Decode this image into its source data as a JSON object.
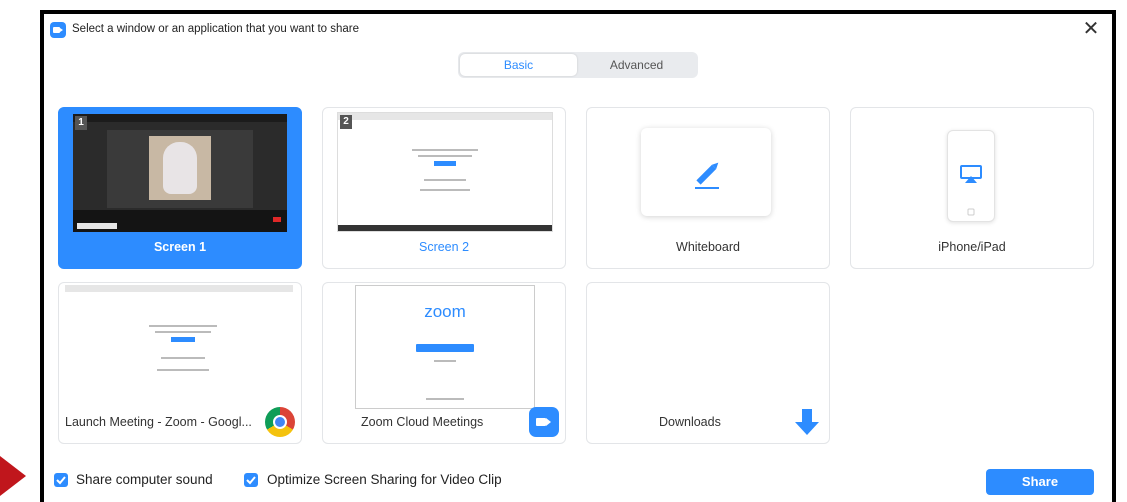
{
  "dialog": {
    "title": "Select a window or an application that you want to share",
    "close": "✕"
  },
  "tabs": [
    {
      "label": "Basic",
      "active": true
    },
    {
      "label": "Advanced",
      "active": false
    }
  ],
  "sources": [
    {
      "label": "Screen 1",
      "badge": "1",
      "selected": true
    },
    {
      "label": "Screen 2",
      "badge": "2",
      "selected": false
    },
    {
      "label": "Whiteboard",
      "icon": "pencil-icon"
    },
    {
      "label": "iPhone/iPad",
      "icon": "airplay-icon"
    },
    {
      "label": "Launch Meeting - Zoom - Googl...",
      "icon": "chrome-icon"
    },
    {
      "label": "Zoom Cloud Meetings",
      "icon": "zoom-app-icon",
      "thumb_text": "zoom"
    },
    {
      "label": "Downloads",
      "icon": "download-arrow-icon"
    }
  ],
  "footer": {
    "share_sound_label": "Share computer sound",
    "share_sound_checked": true,
    "optimize_label": "Optimize Screen Sharing for Video Clip",
    "optimize_checked": true,
    "share_button": "Share"
  },
  "colors": {
    "accent": "#2d8cff",
    "annotation_arrow": "#c0161c"
  }
}
